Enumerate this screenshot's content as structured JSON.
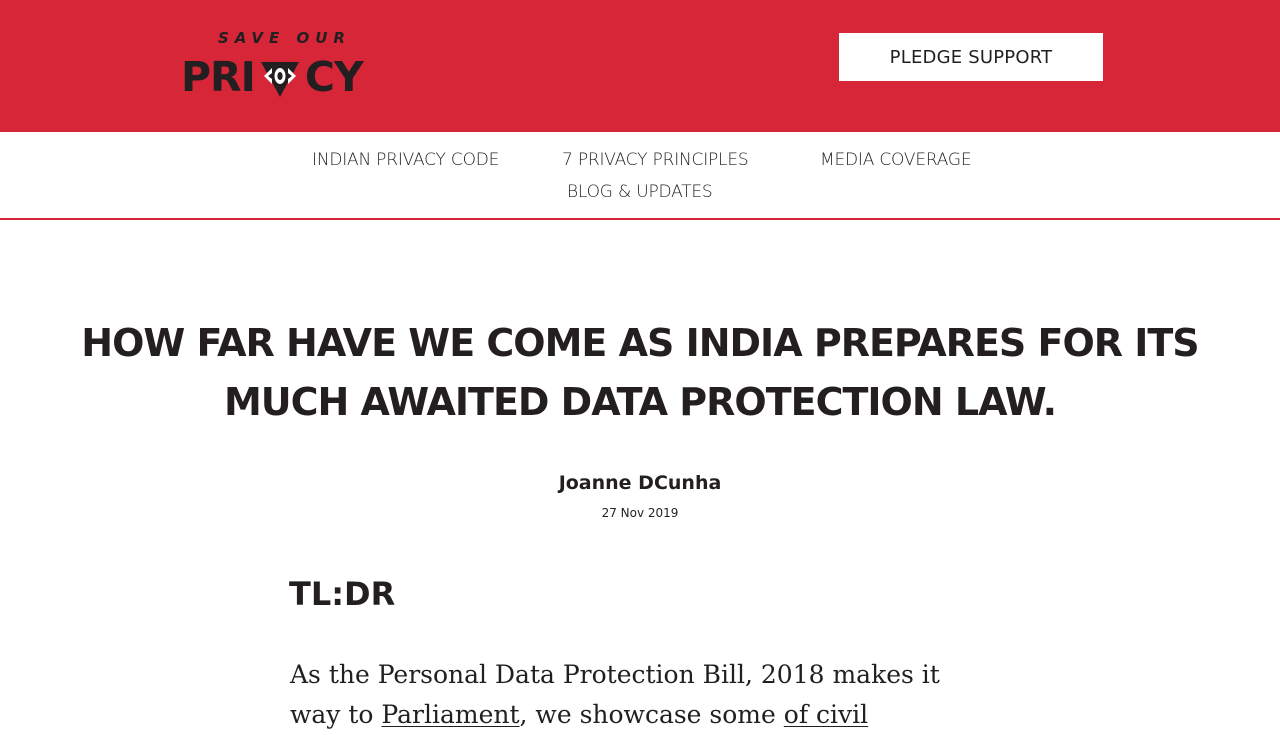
{
  "header": {
    "logo": {
      "tagline": "SAVE OUR",
      "word_left": "PRI",
      "word_right": "CY",
      "mark_icon": "eye-icon"
    },
    "pledge_label": "PLEDGE SUPPORT"
  },
  "nav": {
    "items": [
      {
        "label": "INDIAN PRIVACY CODE"
      },
      {
        "label": "7 PRIVACY PRINCIPLES"
      },
      {
        "label": "MEDIA COVERAGE"
      },
      {
        "label": "BLOG & UPDATES"
      }
    ]
  },
  "article": {
    "title": "HOW FAR HAVE WE COME AS INDIA PREPARES FOR ITS MUCH AWAITED DATA PROTECTION LAW.",
    "author": "Joanne DCunha",
    "date": "27 Nov 2019",
    "tldr_heading": "TL:DR",
    "intro_start": "As the Personal Data Protection Bill, 2018 makes it way to ",
    "link_parliament": "Parliament",
    "intro_middle": ", we showcase some ",
    "link_civil": "of civil",
    "intro_end": ""
  },
  "colors": {
    "brand_red": "#d72638",
    "text_dark": "#231f20",
    "background": "#ffffff"
  }
}
